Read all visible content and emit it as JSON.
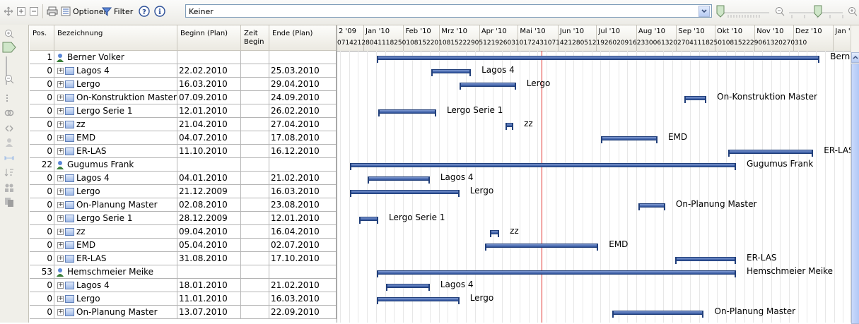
{
  "toolbar": {
    "options_label": "Optionen",
    "filter_label": "Filter",
    "combo_value": "Keiner",
    "icons": [
      "move-icon",
      "expand-all-icon",
      "collapse-all-icon",
      "print-icon",
      "options-icon",
      "filter-icon",
      "help-icon",
      "info-icon",
      "zoom-out-icon",
      "zoom-in-icon"
    ]
  },
  "grid": {
    "headers": {
      "pos": "Pos.",
      "name": "Bezeichnung",
      "start": "Beginn (Plan)",
      "zeit": "Zeit Begin",
      "end": "Ende (Plan)"
    },
    "rows": [
      {
        "pos": "1",
        "name": "Berner Volker",
        "type": "resource",
        "start": "",
        "end": "",
        "bar_start": "2010-01-11",
        "bar_end": "2010-12-21",
        "label": "Berner Volker"
      },
      {
        "pos": "0",
        "name": "Lagos 4",
        "type": "task",
        "start": "22.02.2010",
        "end": "25.03.2010",
        "bar_start": "2010-02-22",
        "bar_end": "2010-03-25",
        "label": "Lagos 4"
      },
      {
        "pos": "0",
        "name": "Lergo",
        "type": "task",
        "start": "16.03.2010",
        "end": "29.04.2010",
        "bar_start": "2010-03-16",
        "bar_end": "2010-04-29",
        "label": "Lergo"
      },
      {
        "pos": "0",
        "name": "On-Konstruktion Master",
        "type": "task",
        "start": "07.09.2010",
        "end": "24.09.2010",
        "bar_start": "2010-09-07",
        "bar_end": "2010-09-24",
        "label": "On-Konstruktion Master"
      },
      {
        "pos": "0",
        "name": "Lergo Serie 1",
        "type": "task",
        "start": "12.01.2010",
        "end": "26.02.2010",
        "bar_start": "2010-01-12",
        "bar_end": "2010-02-26",
        "label": "Lergo Serie 1"
      },
      {
        "pos": "0",
        "name": "zz",
        "type": "task",
        "start": "21.04.2010",
        "end": "27.04.2010",
        "bar_start": "2010-04-21",
        "bar_end": "2010-04-27",
        "label": "zz"
      },
      {
        "pos": "0",
        "name": "EMD",
        "type": "task",
        "start": "04.07.2010",
        "end": "17.08.2010",
        "bar_start": "2010-07-04",
        "bar_end": "2010-08-17",
        "label": "EMD"
      },
      {
        "pos": "0",
        "name": "ER-LAS",
        "type": "task",
        "start": "11.10.2010",
        "end": "16.12.2010",
        "bar_start": "2010-10-11",
        "bar_end": "2010-12-16",
        "label": "ER-LAS"
      },
      {
        "pos": "22",
        "name": "Gugumus Frank",
        "type": "resource",
        "start": "",
        "end": "",
        "bar_start": "2009-12-21",
        "bar_end": "2010-10-17",
        "label": "Gugumus Frank"
      },
      {
        "pos": "0",
        "name": "Lagos 4",
        "type": "task",
        "start": "04.01.2010",
        "end": "21.02.2010",
        "bar_start": "2010-01-04",
        "bar_end": "2010-02-21",
        "label": "Lagos 4"
      },
      {
        "pos": "0",
        "name": "Lergo",
        "type": "task",
        "start": "21.12.2009",
        "end": "16.03.2010",
        "bar_start": "2009-12-21",
        "bar_end": "2010-03-16",
        "label": "Lergo"
      },
      {
        "pos": "0",
        "name": "On-Planung Master",
        "type": "task",
        "start": "02.08.2010",
        "end": "23.08.2010",
        "bar_start": "2010-08-02",
        "bar_end": "2010-08-23",
        "label": "On-Planung Master"
      },
      {
        "pos": "0",
        "name": "Lergo Serie 1",
        "type": "task",
        "start": "28.12.2009",
        "end": "12.01.2010",
        "bar_start": "2009-12-28",
        "bar_end": "2010-01-12",
        "label": "Lergo Serie 1"
      },
      {
        "pos": "0",
        "name": "zz",
        "type": "task",
        "start": "09.04.2010",
        "end": "16.04.2010",
        "bar_start": "2010-04-09",
        "bar_end": "2010-04-16",
        "label": "zz"
      },
      {
        "pos": "0",
        "name": "EMD",
        "type": "task",
        "start": "05.04.2010",
        "end": "02.07.2010",
        "bar_start": "2010-04-05",
        "bar_end": "2010-07-02",
        "label": "EMD"
      },
      {
        "pos": "0",
        "name": "ER-LAS",
        "type": "task",
        "start": "31.08.2010",
        "end": "17.10.2010",
        "bar_start": "2010-08-31",
        "bar_end": "2010-10-17",
        "label": "ER-LAS"
      },
      {
        "pos": "53",
        "name": "Hemschmeier Meike",
        "type": "resource",
        "start": "",
        "end": "",
        "bar_start": "2010-01-11",
        "bar_end": "2010-10-17",
        "label": "Hemschmeier Meike"
      },
      {
        "pos": "0",
        "name": "Lagos 4",
        "type": "task",
        "start": "18.01.2010",
        "end": "21.02.2010",
        "bar_start": "2010-01-18",
        "bar_end": "2010-02-21",
        "label": "Lagos 4"
      },
      {
        "pos": "0",
        "name": "Lergo",
        "type": "task",
        "start": "11.01.2010",
        "end": "16.03.2010",
        "bar_start": "2010-01-11",
        "bar_end": "2010-03-16",
        "label": "Lergo"
      },
      {
        "pos": "0",
        "name": "On-Planung Master",
        "type": "task",
        "start": "13.07.2010",
        "end": "22.09.2010",
        "bar_start": "2010-07-13",
        "bar_end": "2010-09-22",
        "label": "On-Planung Master"
      }
    ]
  },
  "gantt": {
    "months": [
      "2 '09",
      "Jan '10",
      "Feb '10",
      "Mrz '10",
      "Apr '10",
      "Mai '10",
      "Jun '10",
      "Jul '10",
      "Aug '10",
      "Sep '10",
      "Okt '10",
      "Nov '10",
      "Dez '10",
      "Jan '1"
    ],
    "days_text": "07142128041118250108152201081522290512192603101724310714212805121926020916233006132027041118250108152229061320270310",
    "today": "2010-05-19"
  },
  "colors": {
    "bar": "#2c4f98",
    "today_line": "#e0302a",
    "header_bg": "#ebe9e1"
  }
}
